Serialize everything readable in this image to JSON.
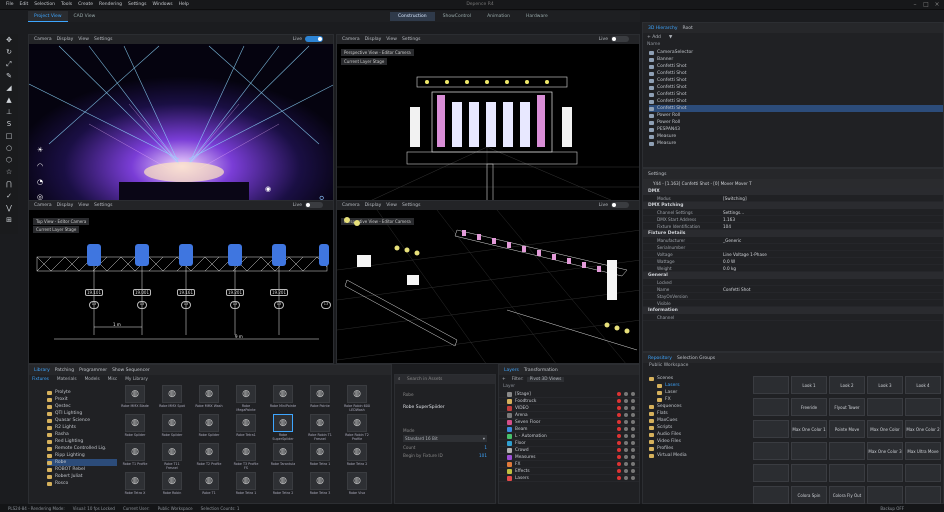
{
  "app": {
    "title": "Depence R4",
    "menu": [
      "File",
      "Edit",
      "Selection",
      "Tools",
      "Create",
      "Rendering",
      "Settings",
      "Windows",
      "Help"
    ]
  },
  "view_tabs": [
    "Project View",
    "CAD View"
  ],
  "modes": [
    "Construction",
    "ShowControl",
    "Animation",
    "Hardware"
  ],
  "viewport_menu": [
    "Camera",
    "Display",
    "View",
    "Settings"
  ],
  "viewports": {
    "top_left": {
      "live_label": "Live",
      "live": true
    },
    "top_right": {
      "live_label": "Live",
      "live": false,
      "label1": "Perspective View - Editor Camera",
      "label2": "Current Layer Stage"
    },
    "bottom_left": {
      "live_label": "Live",
      "live": false,
      "label1": "Top View - Editor Camera",
      "label2": "Current Layer Stage",
      "ids": [
        "19.101",
        "19.001",
        "19.161",
        "19.201",
        "19.201"
      ],
      "circles": [
        "13",
        "13",
        "13",
        "13",
        "13",
        "13"
      ],
      "dim_1": "1 m",
      "dim_2": "9 m"
    },
    "bottom_right": {
      "live_label": "Live",
      "live": false,
      "label1": "Perspective View - Editor Camera"
    }
  },
  "hierarchy": {
    "tabs": [
      "3D Hierarchy",
      "Root"
    ],
    "add_label": "+ Add",
    "column": "Name",
    "items": [
      "CameraSelector",
      "Banner",
      "Confetti Shot",
      "Confetti Shot",
      "Confetti Shot",
      "Confetti Shot",
      "Confetti Shot",
      "Confetti Shot",
      "Confetti Shot",
      "Power Roll",
      "Power Roll",
      "PESPAN43",
      "Measure",
      "Measure"
    ]
  },
  "settings": {
    "header": "Settings",
    "selection": "Y44 - [1.163] Confetti Shot - [0] Mover Mover T",
    "sections": [
      {
        "title": "DMX",
        "rows": [
          {
            "k": "Modus",
            "v": "[Switching]"
          }
        ]
      },
      {
        "title": "DMX Patching",
        "rows": [
          {
            "k": "Channel Settings",
            "v": "Settings..."
          },
          {
            "k": "DMX Start Address",
            "v": "1.163"
          },
          {
            "k": "Fixture Identification",
            "v": "104"
          }
        ]
      },
      {
        "title": "Fixture Details",
        "rows": [
          {
            "k": "Manufacturer",
            "v": "_Generic"
          },
          {
            "k": "Serialnumber",
            "v": ""
          },
          {
            "k": "Voltage",
            "v": "Line Voltage 1-Phase"
          },
          {
            "k": "Wattage",
            "v": "0.0 W"
          },
          {
            "k": "Weight",
            "v": "0.0 kg"
          }
        ]
      },
      {
        "title": "General",
        "rows": [
          {
            "k": "Locked",
            "v": ""
          },
          {
            "k": "Name",
            "v": "Confetti Shot"
          },
          {
            "k": "StayOnVersion",
            "v": ""
          },
          {
            "k": "Visible",
            "v": ""
          }
        ]
      },
      {
        "title": "Information",
        "rows": [
          {
            "k": "Channel",
            "v": ""
          }
        ]
      }
    ]
  },
  "library": {
    "tabs": [
      "Library",
      "Patching",
      "Programmer",
      "Show Sequencer"
    ],
    "subtabs": [
      "Fixtures",
      "Materials",
      "Models",
      "Misc",
      "My Library"
    ],
    "folders": [
      "Prolyte",
      "Proxit",
      "Qestec",
      "QTI Lighting",
      "Quasar Science",
      "R2 Lights",
      "Rasha",
      "Red Lighting",
      "Remote Controlled Lig.",
      "Ripp Lighting",
      "Robe",
      "ROBOT Rebel",
      "Robert Juliat",
      "Rosco"
    ],
    "selected_folder": "Robe",
    "search_placeholder": "Search in Assets",
    "assets": [
      [
        "Robe MMX Blade",
        "Robe MMX Spot",
        "Robe MMX Wash",
        "Robe MegaPointe",
        "Robe MiniPointe",
        "Robe Pointe",
        "Robe Robin 600 LEDWash"
      ],
      [
        "Robe Spiider",
        "Robe Spiider",
        "Robe Spiider",
        "Robe Tetra1",
        "Robe SuperSpiider",
        "Robe Robin T1 Fresnel",
        "Robe Robin T2 Profile"
      ],
      [
        "Robe T1 Profile",
        "Robe T11 Fresnel",
        "Robe T2 Profile",
        "Robe T3 Profile FS",
        "Robe Tarantula",
        "Robe Tetra 1",
        "Robe Tetra 2"
      ],
      [
        "Robe Tetra X",
        "Robe Robin",
        "Robe T1",
        "Robe Tetra 1",
        "Robe Tetra 2",
        "Robe Tetra 3",
        "Robe Viva"
      ]
    ],
    "selected_asset": "Robe SuperSpiider"
  },
  "fixture_detail": {
    "label": "Robe",
    "name": "Robe SuperSpiider",
    "mode_label": "Mode",
    "mode_value": "Standard 16 Bit",
    "count_label": "Count",
    "count_value": "1",
    "fixture_id_label": "Begin by Fixture ID",
    "fixture_id_value": "101"
  },
  "layers": {
    "tabs": [
      "Layers",
      "Transformation"
    ],
    "filter_label": "Filter:",
    "filter_value": "Pivot 3D Views",
    "column": "Layer",
    "items": [
      {
        "name": "[Stage]",
        "color": "#8a8a8a"
      },
      {
        "name": "Foodtruck",
        "color": "#d6b15c"
      },
      {
        "name": "VIDEO",
        "color": "#c33d3d"
      },
      {
        "name": "Arena",
        "color": "#7a7a7a"
      },
      {
        "name": "Seven Floor",
        "color": "#d44f8a"
      },
      {
        "name": "Beam",
        "color": "#3b8be0"
      },
      {
        "name": "L - Automation",
        "color": "#48c06a"
      },
      {
        "name": "Floor",
        "color": "#2f9fd0"
      },
      {
        "name": "Crowd",
        "color": "#b0b0b0"
      },
      {
        "name": "Measures",
        "color": "#9e4fd6"
      },
      {
        "name": "FX",
        "color": "#e07a3b"
      },
      {
        "name": "Effects",
        "color": "#c0c040"
      },
      {
        "name": "Lasers",
        "color": "#e34a4a"
      }
    ]
  },
  "workspace": {
    "tabs": [
      "Repository",
      "Selection Groups"
    ],
    "title": "Public Workspace",
    "tree": [
      "Scenes",
      "Lasers",
      "Laser",
      "FX",
      "Sequences",
      "Flats",
      "MaxCues",
      "Scripts",
      "Audio Files",
      "Video Files",
      "Profiles",
      "Virtual Media"
    ],
    "grid": [
      [
        "",
        "Look 1",
        "Look 2",
        "Look 3",
        "Look 4"
      ],
      [
        "",
        "Freeride",
        "Flyout Tower",
        "",
        ""
      ],
      [
        "",
        "Max One Color 1",
        "Pointe Move",
        "Max One Color",
        "Max One Color 2"
      ],
      [
        "",
        "",
        "",
        "Max One Color 3",
        "Max Ultra Move"
      ],
      [
        "",
        "",
        "",
        "",
        ""
      ],
      [
        "",
        "Colora Spin",
        "Colora Fly Out",
        "",
        ""
      ]
    ]
  },
  "statusbar": [
    "PLS24-84 - Rendering Mode: ",
    "Visual: 10 fps Locked",
    "Current User: ",
    "Public Workspace",
    "Selection Counts: 1"
  ],
  "backup_label": "Backup OFF"
}
